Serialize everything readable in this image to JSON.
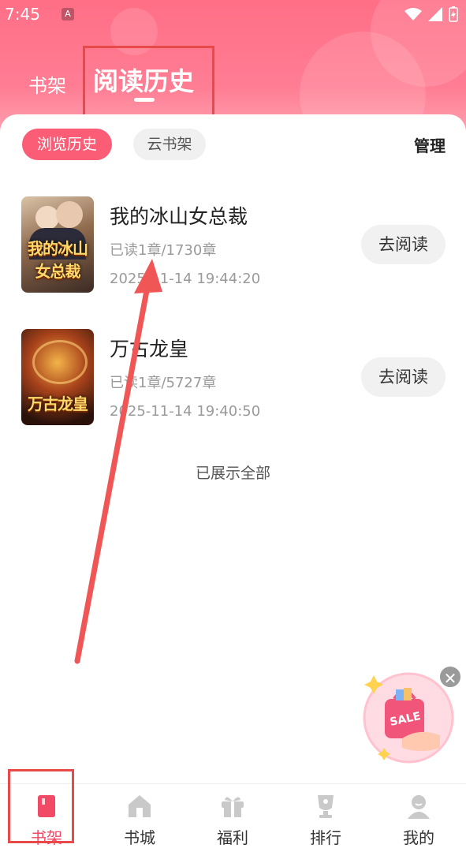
{
  "status_bar": {
    "time": "7:45",
    "notification_icon": "A"
  },
  "header": {
    "tab_bookshelf": "书架",
    "tab_history": "阅读历史"
  },
  "filters": {
    "browse_history": "浏览历史",
    "cloud_shelf": "云书架",
    "manage": "管理"
  },
  "books": [
    {
      "title": "我的冰山女总裁",
      "progress": "已读1章/1730章",
      "time": "2025-11-14 19:44:20",
      "cover_text": "我的冰山女总裁",
      "button": "去阅读"
    },
    {
      "title": "万古龙皇",
      "progress": "已读1章/5727章",
      "time": "2025-11-14 19:40:50",
      "cover_text": "万古龙皇",
      "button": "去阅读"
    }
  ],
  "list_footer": "已展示全部",
  "promo": {
    "badge": "SALE"
  },
  "bottom_nav": [
    {
      "label": "书架",
      "icon": "bookshelf-icon",
      "active": true
    },
    {
      "label": "书城",
      "icon": "home-icon",
      "active": false
    },
    {
      "label": "福利",
      "icon": "gift-icon",
      "active": false
    },
    {
      "label": "排行",
      "icon": "trophy-icon",
      "active": false
    },
    {
      "label": "我的",
      "icon": "profile-icon",
      "active": false
    }
  ],
  "colors": {
    "accent": "#fb5d77",
    "header": "#ff7d93",
    "annotation": "#e84a4a"
  }
}
